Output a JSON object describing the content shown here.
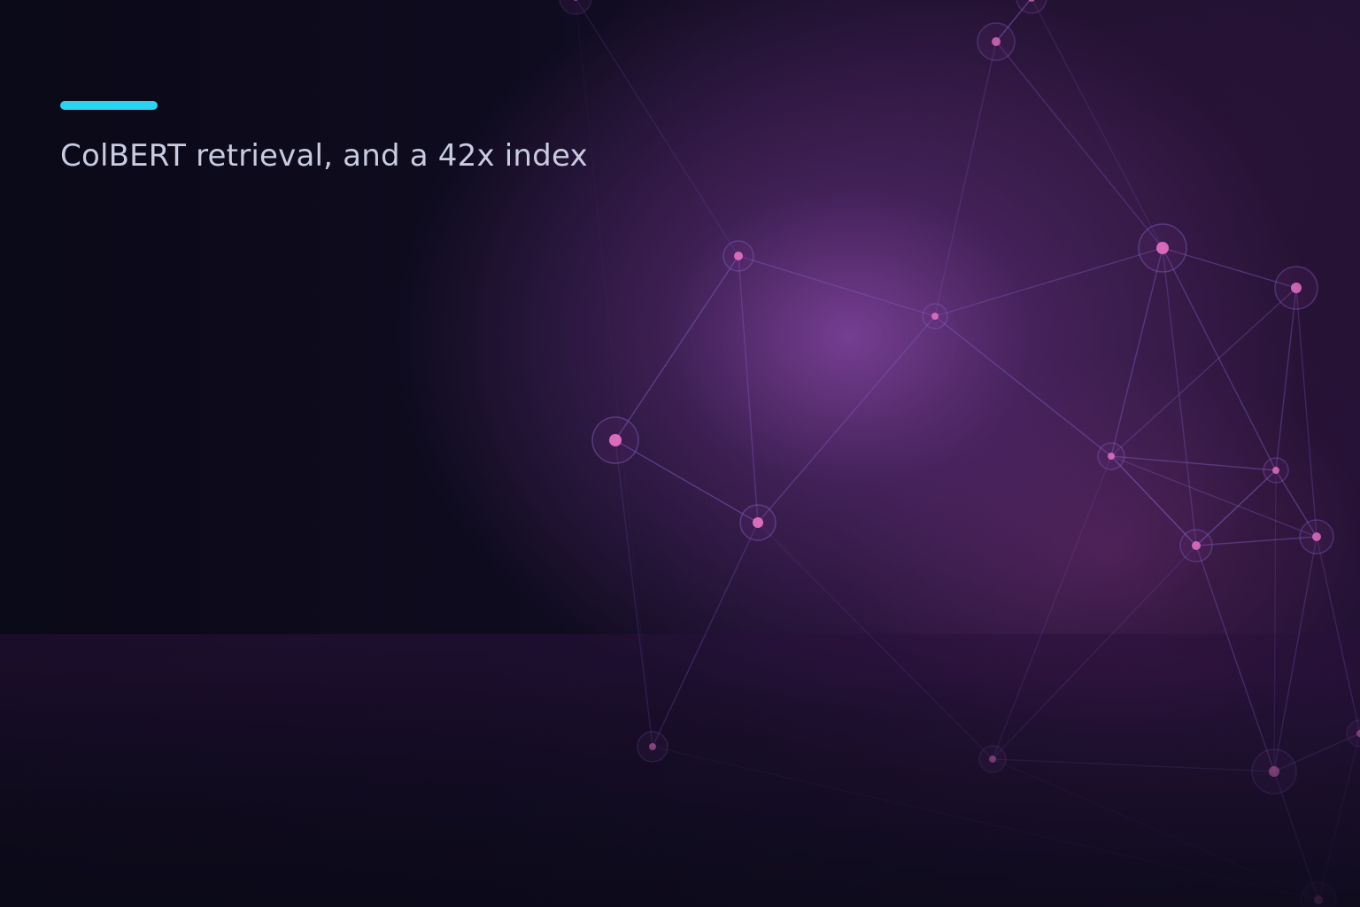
{
  "headline": "ColBERT retrieval, and a 42x index",
  "colors": {
    "accent": "#2ad4ee",
    "headline_text": "#c9cbe0",
    "background": "#0b0a18",
    "glow": "#7a4096",
    "node": "#e06ec0",
    "edge": "#7a5ab8"
  }
}
